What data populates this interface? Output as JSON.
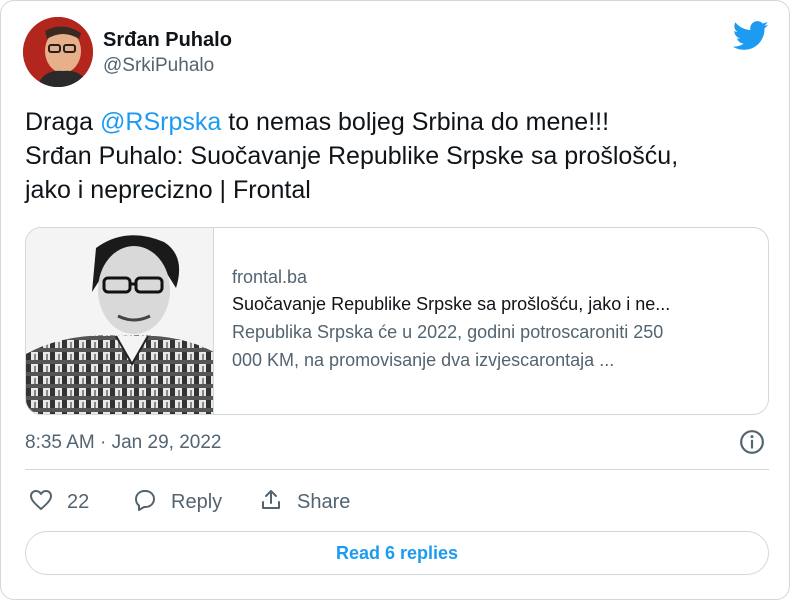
{
  "author": {
    "display_name": "Srđan Puhalo",
    "handle": "@SrkiPuhalo"
  },
  "tweet": {
    "text_before_mention": "Draga ",
    "mention": "@RSrpska",
    "text_after_mention": " to nemas boljeg Srbina do mene!!!",
    "line2": "Srđan Puhalo: Suočavanje Republike Srpske sa prošlošću,",
    "line3": "jako i neprecizno | Frontal"
  },
  "link_card": {
    "domain": "frontal.ba",
    "title": "Suočavanje Republike Srpske sa prošlošću, jako i ne...",
    "description_line1": "Republika Srpska će u 2022, godini potroscaroniti 250",
    "description_line2": "000 KM, na promovisanje dva izvjescarontaja ..."
  },
  "meta": {
    "timestamp": "8:35 AM · Jan 29, 2022"
  },
  "actions": {
    "like_count": "22",
    "reply_label": "Reply",
    "share_label": "Share"
  },
  "read_replies": {
    "label": "Read 6 replies"
  },
  "colors": {
    "accent": "#1d9bf0",
    "text_primary": "#0f1419",
    "text_secondary": "#536471",
    "border": "#cfd9de"
  },
  "icons": [
    "twitter-bird-icon",
    "info-icon",
    "heart-icon",
    "reply-icon",
    "share-icon"
  ]
}
